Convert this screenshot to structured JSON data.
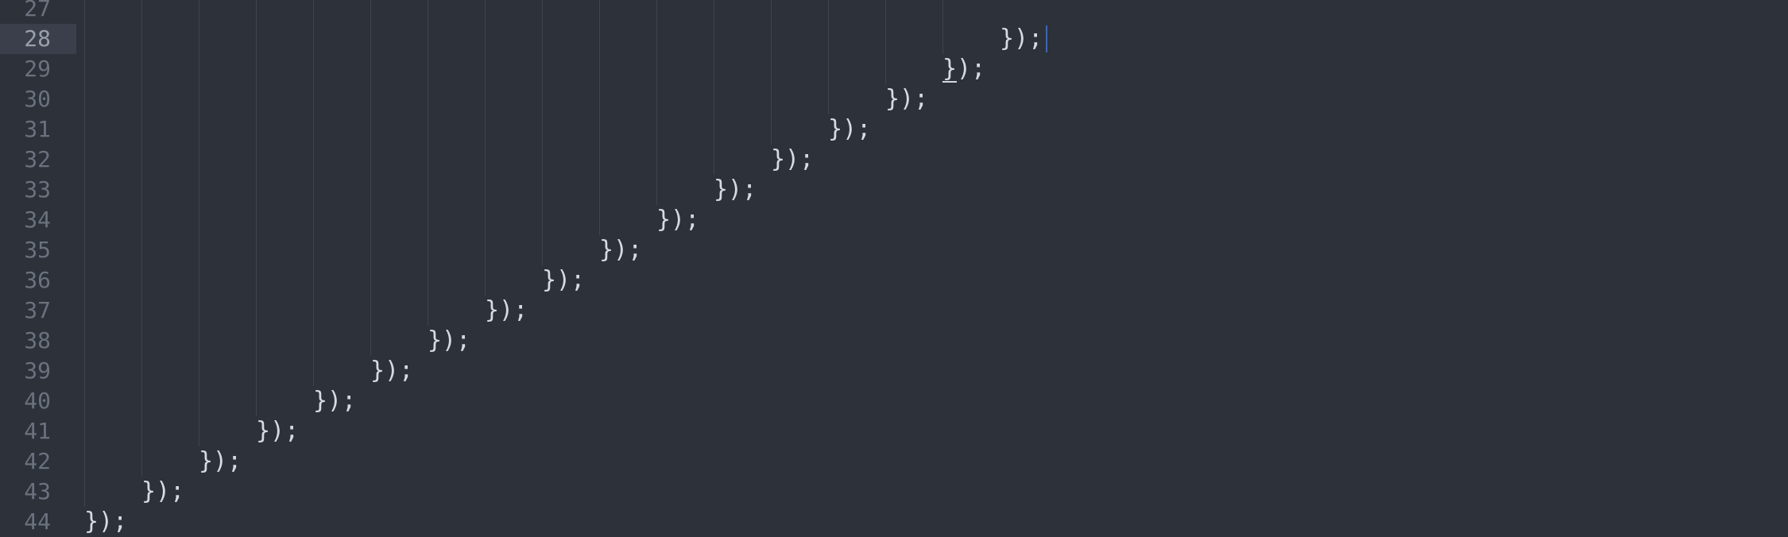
{
  "editor": {
    "lines": [
      {
        "number": "27",
        "text": ""
      },
      {
        "number": "28",
        "text": "});",
        "indent": 16,
        "active": true
      },
      {
        "number": "29",
        "text": "});",
        "indent": 15
      },
      {
        "number": "30",
        "text": "});",
        "indent": 14
      },
      {
        "number": "31",
        "text": "});",
        "indent": 13
      },
      {
        "number": "32",
        "text": "});",
        "indent": 12
      },
      {
        "number": "33",
        "text": "});",
        "indent": 11
      },
      {
        "number": "34",
        "text": "});",
        "indent": 10
      },
      {
        "number": "35",
        "text": "});",
        "indent": 9
      },
      {
        "number": "36",
        "text": "});",
        "indent": 8
      },
      {
        "number": "37",
        "text": "});",
        "indent": 7
      },
      {
        "number": "38",
        "text": "});",
        "indent": 6
      },
      {
        "number": "39",
        "text": "});",
        "indent": 5
      },
      {
        "number": "40",
        "text": "});",
        "indent": 4
      },
      {
        "number": "41",
        "text": "});",
        "indent": 3
      },
      {
        "number": "42",
        "text": "});",
        "indent": 2
      },
      {
        "number": "43",
        "text": "});",
        "indent": 1
      },
      {
        "number": "44",
        "text": "});",
        "indent": 0
      }
    ],
    "colors": {
      "background": "#2c313a",
      "gutter_highlight": "#3a3f4b",
      "line_number": "#6b717d",
      "text": "#d7dae0",
      "indent_guide": "#3e4451",
      "caret": "#528bff"
    }
  }
}
